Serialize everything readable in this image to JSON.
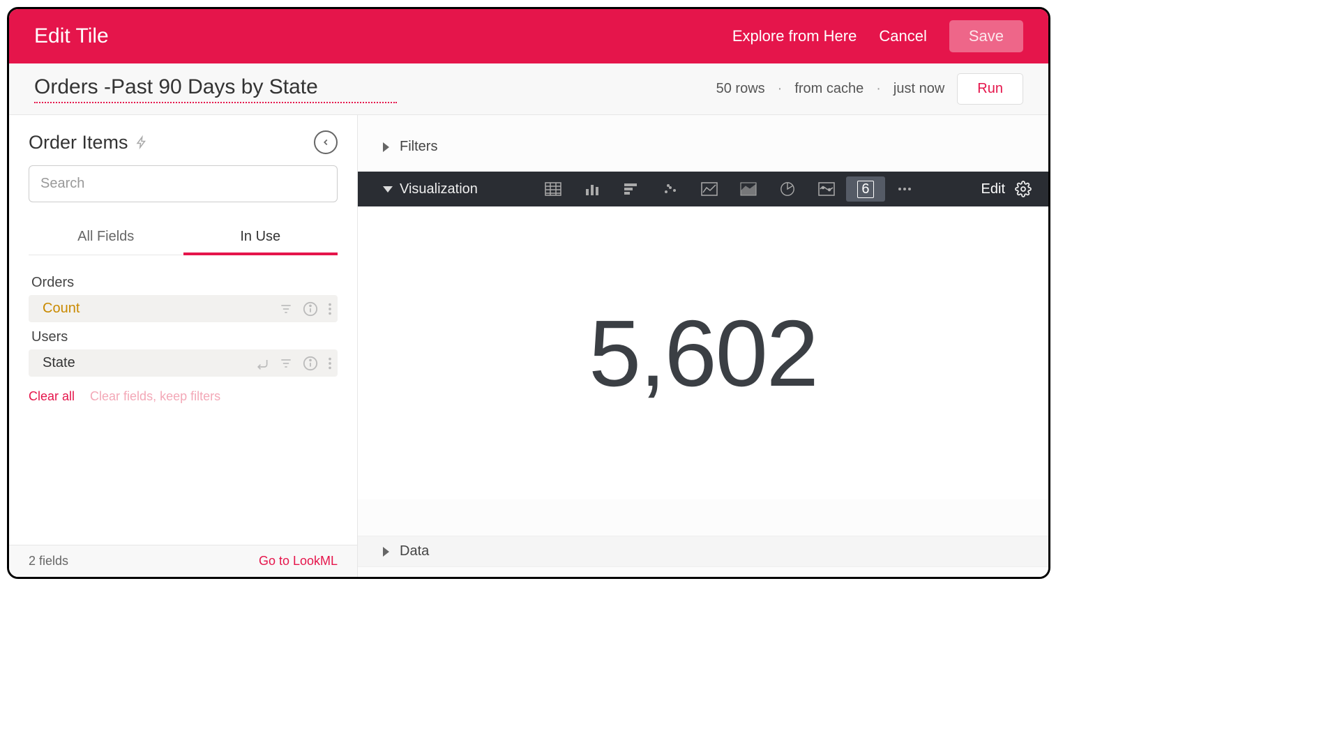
{
  "header": {
    "title": "Edit Tile",
    "explore_link": "Explore from Here",
    "cancel": "Cancel",
    "save": "Save"
  },
  "subheader": {
    "tile_title": "Orders -Past 90 Days by State",
    "rows": "50 rows",
    "cache": "from cache",
    "time": "just now",
    "run": "Run"
  },
  "sidebar": {
    "explore_name": "Order Items",
    "search_placeholder": "Search",
    "tabs": {
      "all": "All Fields",
      "in_use": "In Use"
    },
    "groups": [
      {
        "label": "Orders",
        "fields": [
          {
            "name": "Count",
            "type": "measure"
          }
        ]
      },
      {
        "label": "Users",
        "fields": [
          {
            "name": "State",
            "type": "dimension"
          }
        ]
      }
    ],
    "clear_all": "Clear all",
    "clear_keep": "Clear fields, keep filters",
    "footer_fields": "2 fields",
    "footer_lookml": "Go to LookML"
  },
  "main": {
    "filters_label": "Filters",
    "vis_label": "Visualization",
    "vis_edit": "Edit",
    "single_value_glyph": "6",
    "data_label": "Data"
  },
  "chart_data": {
    "type": "single_value",
    "value": 5602,
    "display": "5,602",
    "title": "Orders -Past 90 Days by State",
    "rows": 50
  }
}
